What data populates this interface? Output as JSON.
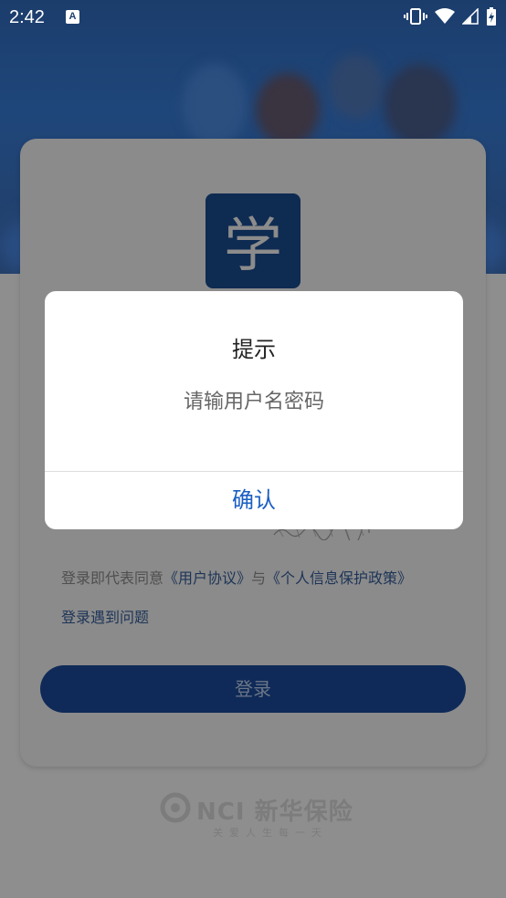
{
  "status_bar": {
    "time": "2:42",
    "notification_icon_letter": "A"
  },
  "login": {
    "logo_text": "学",
    "agreement": {
      "prefix": "登录即代表同意",
      "user_agreement": "《用户协议》",
      "conjunction": "与",
      "privacy_policy": "《个人信息保护政策》"
    },
    "problem_link": "登录遇到问题",
    "login_button": "登录"
  },
  "brand": {
    "name": "NCI 新华保险",
    "slogan": "关爱人生每一天"
  },
  "dialog": {
    "title": "提示",
    "message": "请输用户名密码",
    "confirm_label": "确认"
  },
  "colors": {
    "primary": "#0f2a58",
    "dialog_button": "#1b5fc2"
  }
}
